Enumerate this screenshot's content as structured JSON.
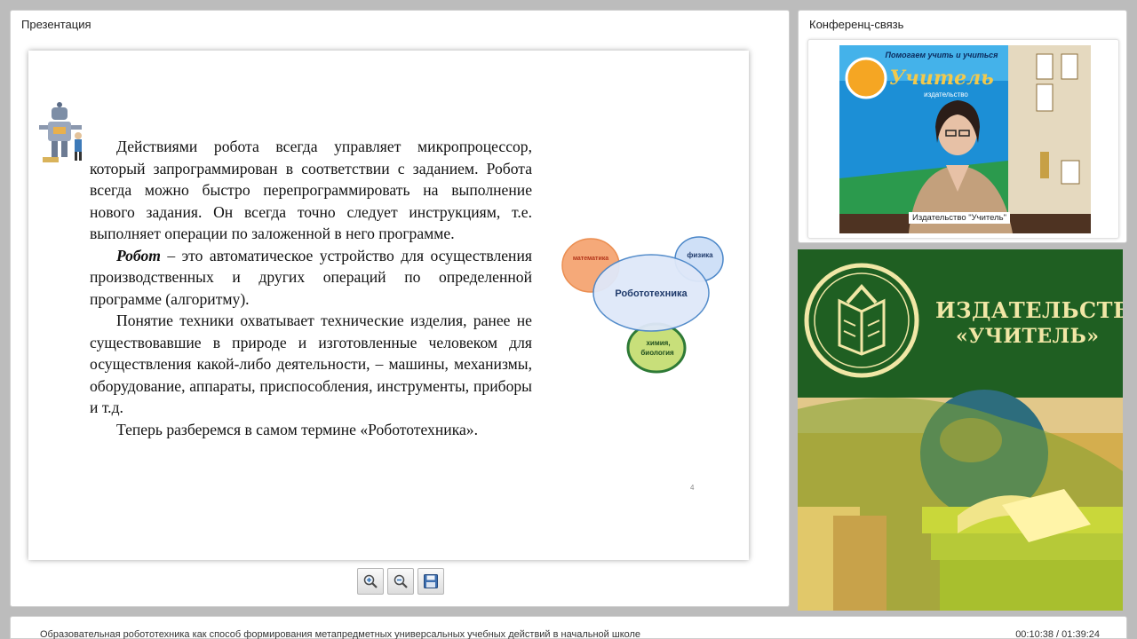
{
  "presentation_panel": {
    "title": "Презентация",
    "slide": {
      "paragraphs": [
        "Действиями робота всегда управляет микропроцессор, который запрограммирован в соответствии с заданием. Робота всегда можно быстро перепрограммировать на выполнение нового задания. Он всегда точно следует инструкциям, т.е. выполняет операции по заложенной в него программе."
      ],
      "definition_term": "Робот",
      "definition_text": " – это автоматическое устройство для осуществления производственных и других операций по определенной программе (алгоритму).",
      "paragraph3": "Понятие техники охватывает технические изделия, ранее не существовавшие в природе и изготовленные человеком для осуществления какой-либо деятельности, – машины, механизмы, оборудование, аппараты, приспособления, инструменты, приборы и т.д.",
      "paragraph4": "Теперь разберемся в самом термине «Робототехника».",
      "page_number": "4",
      "diagram": {
        "center": "Робототехника",
        "math": "математика",
        "physics": "физика",
        "chem1": "химия,",
        "chem2": "биология"
      }
    },
    "toolbar": {
      "zoom_in": "zoom-in-icon",
      "zoom_out": "zoom-out-icon",
      "save": "save-icon"
    }
  },
  "conference_panel": {
    "title": "Конференц-связь",
    "participant_label": "Издательство \"Учитель\"",
    "banner_text": "Помогаем учить и учиться",
    "banner_brand": "Учитель",
    "banner_sub": "издательство"
  },
  "brand_panel": {
    "line1": "ИЗДАТЕЛЬСТВО",
    "line2": "«УЧИТЕЛЬ»",
    "colors": {
      "green": "#1f5f22",
      "gold": "#f1e7a6"
    }
  },
  "status_bar": {
    "course_title": "Образовательная робототехника как способ формирования метапредметных универсальных учебных действий в начальной школе",
    "time": "00:10:38 / 01:39:24"
  }
}
